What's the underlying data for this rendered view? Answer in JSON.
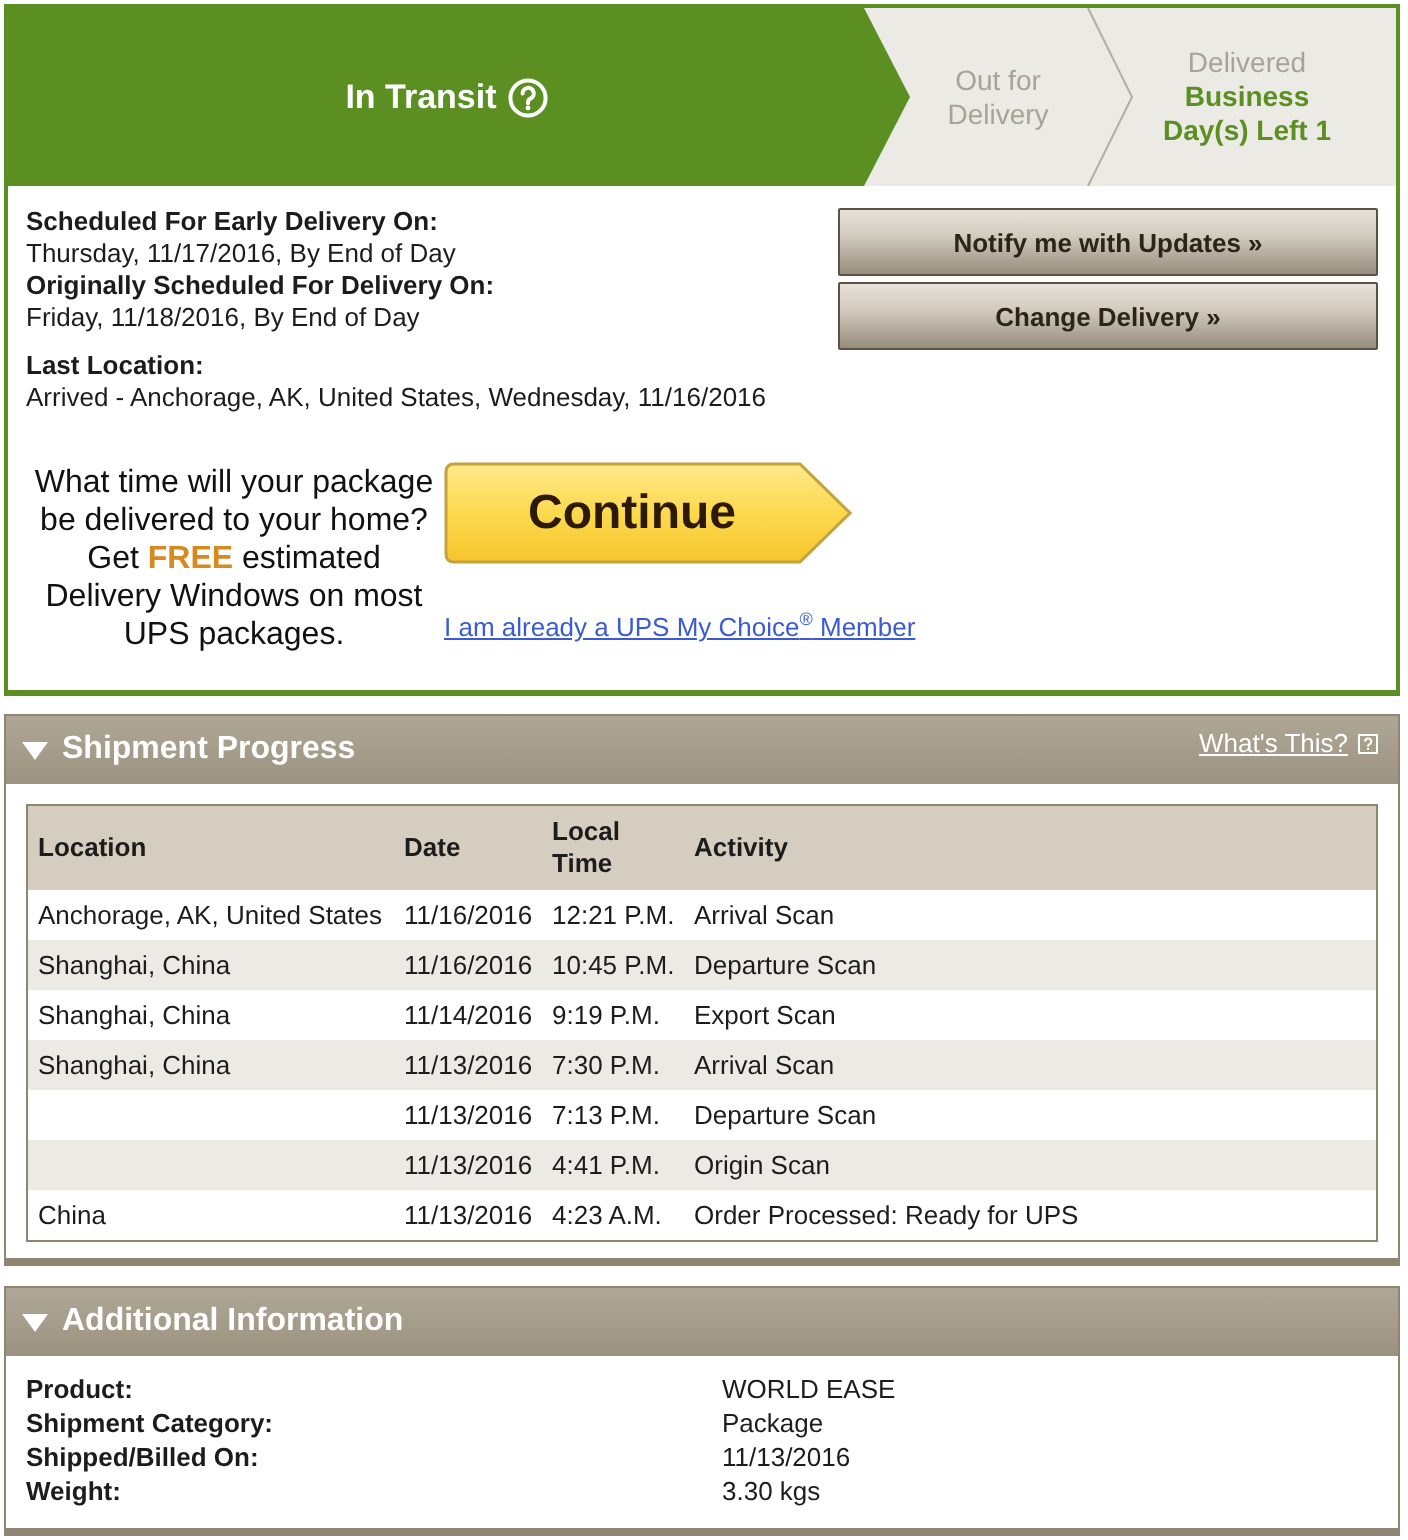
{
  "progress_steps": [
    {
      "label": "In Transit",
      "current": true
    },
    {
      "label": "Out for Delivery",
      "current": false
    },
    {
      "label": "Delivered",
      "current": false,
      "note": "Business Day(s) Left 1"
    }
  ],
  "delivery": {
    "dates": [
      {
        "label": "Scheduled For Early Delivery On:",
        "value": "Thursday, 11/17/2016, By End of Day"
      },
      {
        "label": "Originally Scheduled For Delivery On:",
        "value": "Friday, 11/18/2016, By End of Day"
      }
    ],
    "last_location": {
      "label": "Last Location:",
      "value": "Arrived - Anchorage, AK, United States, Wednesday, 11/16/2016"
    }
  },
  "actions": [
    "Notify me with Updates »",
    "Change Delivery »"
  ],
  "promo": {
    "text": "What time will your package be delivered to your home? Get **FREE** estimated Delivery Windows on most UPS packages.",
    "button": "Continue",
    "link": "I am already a UPS My Choice$^{®}$ Member"
  },
  "shipment_progress": {
    "title": "Shipment Progress",
    "expanded": true,
    "help_link": "What's This?",
    "columns": [
      "Location",
      "Date",
      "Local Time",
      "Activity"
    ],
    "rows": [
      {
        "location": "Anchorage, AK, United States",
        "date": "11/16/2016",
        "time": "12:21 P.M.",
        "activity": "Arrival Scan"
      },
      {
        "location": "Shanghai, China",
        "date": "11/16/2016",
        "time": "10:45 P.M.",
        "activity": "Departure Scan"
      },
      {
        "location": "Shanghai, China",
        "date": "11/14/2016",
        "time": "9:19 P.M.",
        "activity": "Export Scan"
      },
      {
        "location": "Shanghai, China",
        "date": "11/13/2016",
        "time": "7:30 P.M.",
        "activity": "Arrival Scan"
      },
      {
        "date": "11/13/2016",
        "time": "7:13 P.M.",
        "activity": "Departure Scan"
      },
      {
        "date": "11/13/2016",
        "time": "4:41 P.M.",
        "activity": "Origin Scan"
      },
      {
        "location": "China",
        "date": "11/13/2016",
        "time": "4:23 A.M.",
        "activity": "Order Processed: Ready for UPS"
      }
    ]
  },
  "additional_information": {
    "title": "Additional Information",
    "expanded": true,
    "fields": [
      {
        "label": "Product:",
        "value": "WORLD EASE"
      },
      {
        "label": "Shipment Category:",
        "value": "Package"
      },
      {
        "label": "Shipped/Billed On:",
        "value": "11/13/2016"
      },
      {
        "label": "Weight:",
        "value": "3.30 kgs"
      }
    ]
  }
}
